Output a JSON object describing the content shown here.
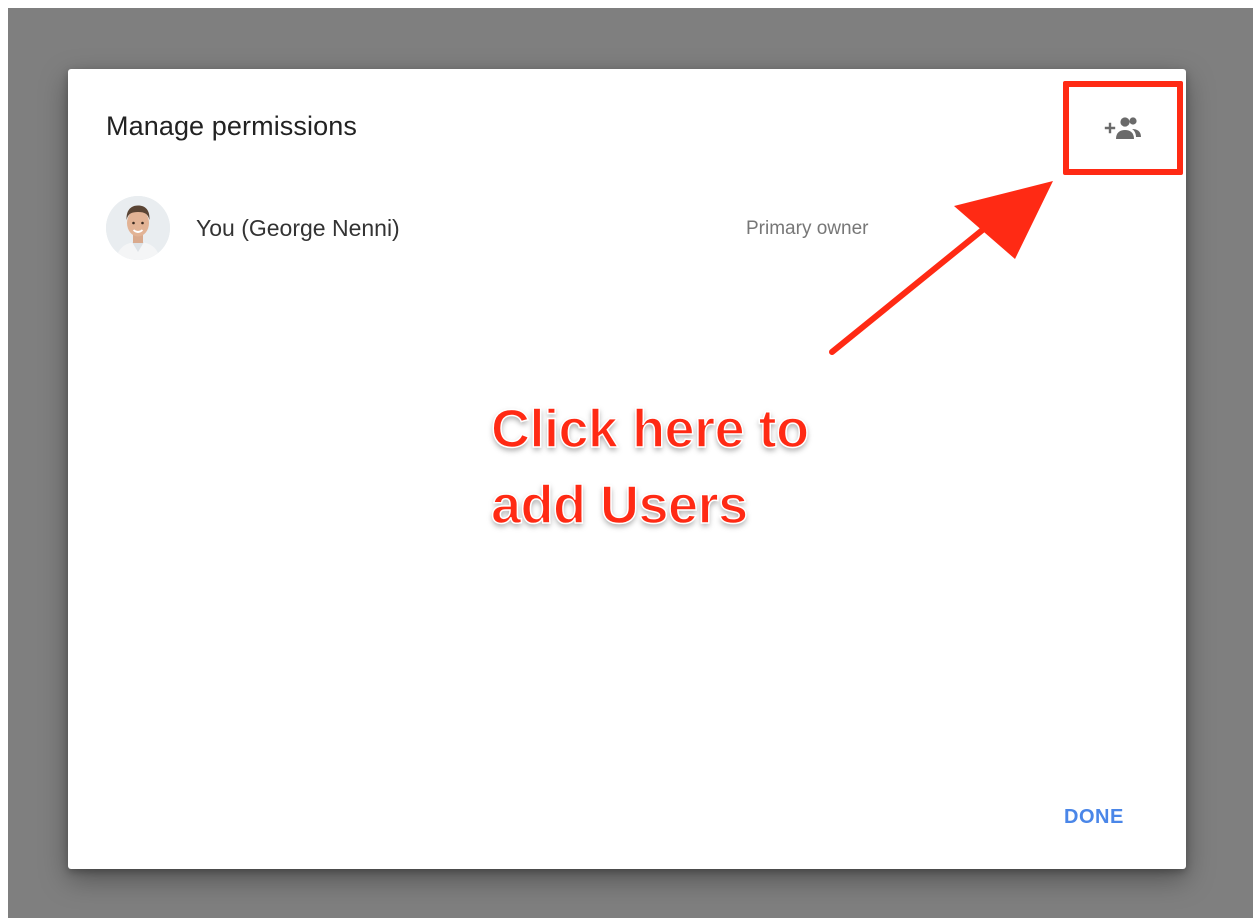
{
  "dialog": {
    "title": "Manage permissions",
    "add_user_icon": "person-add-icon",
    "done_label": "DONE"
  },
  "members": [
    {
      "name": "You (George Nenni)",
      "role": "Primary owner",
      "avatar_icon": "avatar"
    }
  ],
  "annotation": {
    "line1": "Click here to",
    "line2": "add Users",
    "color": "#ff2a14"
  },
  "colors": {
    "overlay": "#7f7f7f",
    "accent": "#4a86e8",
    "highlight": "#ff2a14"
  }
}
